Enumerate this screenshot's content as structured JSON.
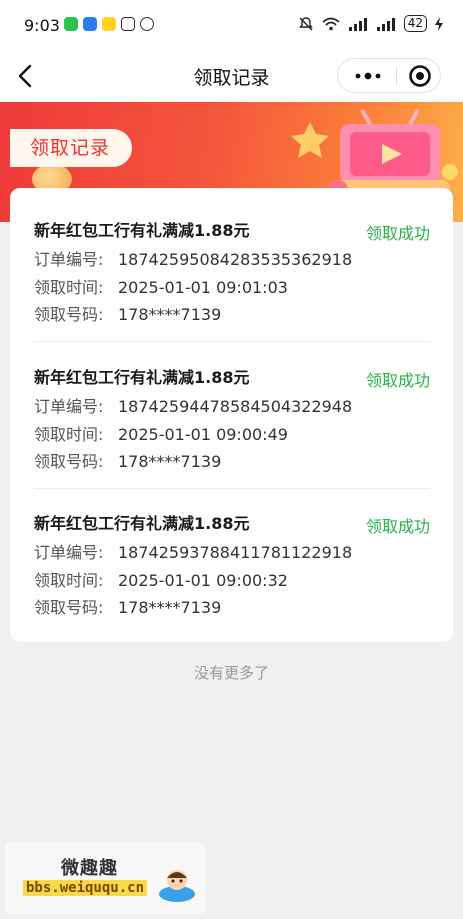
{
  "status_bar": {
    "time": "9:03",
    "battery": "42"
  },
  "nav": {
    "title": "领取记录"
  },
  "banner": {
    "tag_label": "领取记录"
  },
  "records": [
    {
      "title": "新年红包工行有礼满减1.88元",
      "status": "领取成功",
      "order_label": "订单编号:",
      "order_no": "1874259508428353536291 8",
      "time_label": "领取时间:",
      "time": "2025-01-01 09:01:03",
      "phone_label": "领取号码:",
      "phone": "178****7139"
    },
    {
      "title": "新年红包工行有礼满减1.88元",
      "status": "领取成功",
      "order_label": "订单编号:",
      "order_no": "1874259447858450432294 8",
      "time_label": "领取时间:",
      "time": "2025-01-01 09:00:49",
      "phone_label": "领取号码:",
      "phone": "178****7139"
    },
    {
      "title": "新年红包工行有礼满减1.88元",
      "status": "领取成功",
      "order_label": "订单编号:",
      "order_no": "1874259378841178112291 8",
      "time_label": "领取时间:",
      "time": "2025-01-01 09:00:32",
      "phone_label": "领取号码:",
      "phone": "178****7139"
    }
  ],
  "footer": {
    "no_more": "没有更多了"
  },
  "watermark": {
    "title": "微趣趣",
    "url": "bbs.weiququ.cn"
  },
  "colors": {
    "success": "#28b34a",
    "banner_red": "#ee3a3a",
    "tag_text": "#e8342f"
  }
}
